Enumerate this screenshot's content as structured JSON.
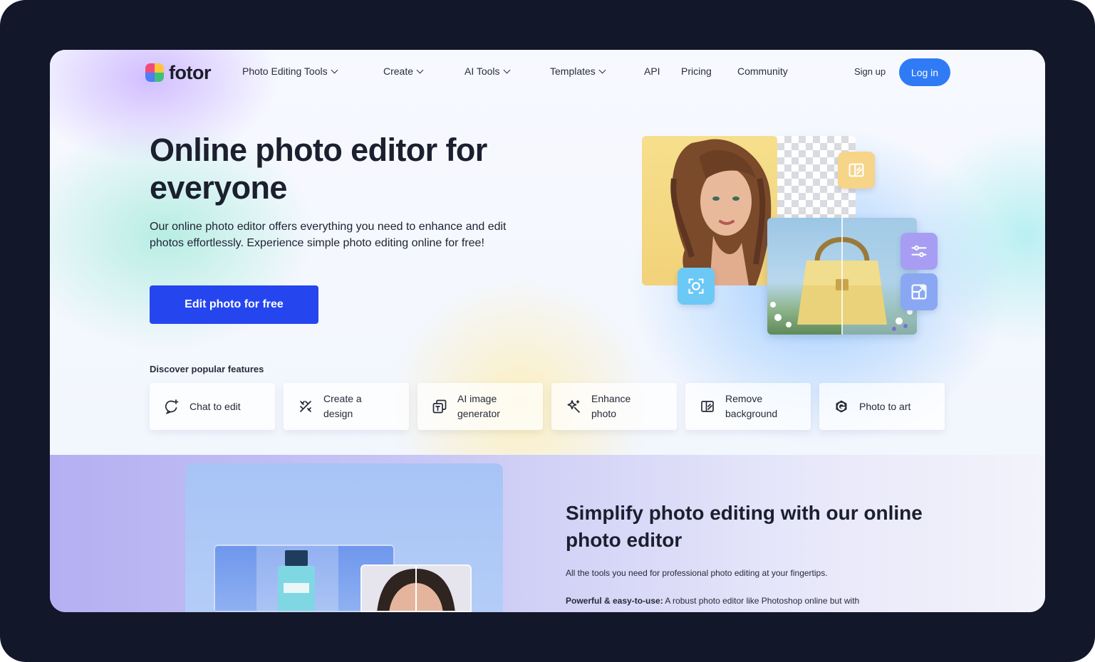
{
  "brand": {
    "name": "fotor",
    "colors": [
      "#f14b7c",
      "#ffc53d",
      "#3fbf7f",
      "#4f7cf7"
    ]
  },
  "nav": {
    "items": [
      {
        "label": "Photo Editing Tools",
        "dropdown": true
      },
      {
        "label": "Create",
        "dropdown": true
      },
      {
        "label": "AI Tools",
        "dropdown": true
      },
      {
        "label": "Templates",
        "dropdown": true
      },
      {
        "label": "API",
        "dropdown": false
      },
      {
        "label": "Pricing",
        "dropdown": false
      },
      {
        "label": "Community",
        "dropdown": false
      }
    ],
    "signup": "Sign up",
    "login": "Log in"
  },
  "hero": {
    "title": "Online photo editor for everyone",
    "subtitle": "Our online photo editor offers everything you need to enhance and edit photos effortlessly. Experience simple photo editing online for free!",
    "cta": "Edit photo for free",
    "discover": "Discover popular features",
    "features": [
      {
        "label": "Chat to edit",
        "icon": "chat-sparkle-icon"
      },
      {
        "label": "Create a\ndesign",
        "icon": "design-tools-icon"
      },
      {
        "label": "AI image\ngenerator",
        "icon": "image-text-icon"
      },
      {
        "label": "Enhance\nphoto",
        "icon": "magic-wand-icon"
      },
      {
        "label": "Remove\nbackground",
        "icon": "remove-background-icon"
      },
      {
        "label": "Photo to art",
        "icon": "art-logo-icon"
      }
    ]
  },
  "section2": {
    "title": "Simplify photo editing with our online photo editor",
    "intro": "All the tools you need for professional photo editing at your fingertips.",
    "point_label": "Powerful & easy-to-use:",
    "point_text": " A robust photo editor like Photoshop online but with"
  },
  "accent": {
    "primary": "#2546ef",
    "login": "#2f7bf5"
  }
}
